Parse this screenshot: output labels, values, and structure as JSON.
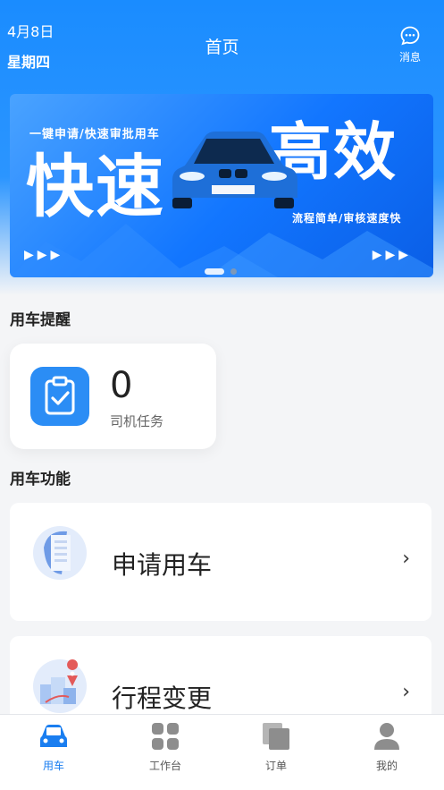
{
  "header": {
    "date": "4月8日",
    "weekday": "星期四",
    "title": "首页",
    "message_label": "消息"
  },
  "banner": {
    "subtitle_top": "一键申请/快速审批用车",
    "headline_left": "快速",
    "headline_right": "高效",
    "subtitle_bottom": "流程简单/审核速度快",
    "arrows": "▶▶▶",
    "active_slide": 1,
    "slide_count": 2
  },
  "reminder": {
    "section_title": "用车提醒",
    "task_count": "0",
    "task_label": "司机任务"
  },
  "functions": {
    "section_title": "用车功能",
    "items": [
      {
        "label": "申请用车",
        "chevron": "›",
        "icon": "document-building-icon"
      },
      {
        "label": "行程变更",
        "chevron": "›",
        "icon": "route-map-icon"
      }
    ]
  },
  "tabbar": {
    "items": [
      {
        "label": "用车",
        "icon": "car-icon",
        "active": true
      },
      {
        "label": "工作台",
        "icon": "grid-icon",
        "active": false
      },
      {
        "label": "订单",
        "icon": "orders-icon",
        "active": false
      },
      {
        "label": "我的",
        "icon": "user-icon",
        "active": false
      }
    ]
  },
  "colors": {
    "primary": "#1a8cff",
    "active_tab": "#1a7ef0",
    "inactive_tab": "#9a9a9a"
  }
}
